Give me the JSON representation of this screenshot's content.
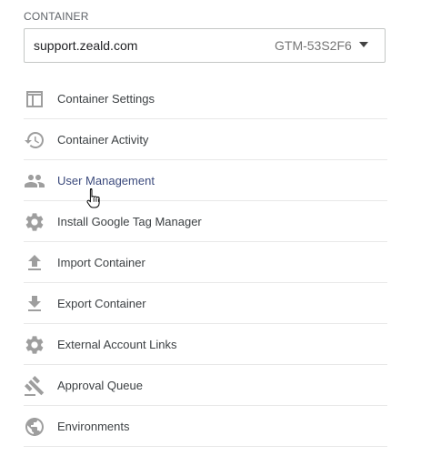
{
  "container": {
    "section_label": "CONTAINER",
    "selected_domain": "support.zeald.com",
    "selected_id": "GTM-53S2F6"
  },
  "menu": {
    "items": [
      {
        "label": "Container Settings",
        "icon": "container-settings-icon"
      },
      {
        "label": "Container Activity",
        "icon": "history-icon"
      },
      {
        "label": "User Management",
        "icon": "people-icon"
      },
      {
        "label": "Install Google Tag Manager",
        "icon": "gear-icon"
      },
      {
        "label": "Import Container",
        "icon": "upload-icon"
      },
      {
        "label": "Export Container",
        "icon": "download-icon"
      },
      {
        "label": "External Account Links",
        "icon": "gear-icon"
      },
      {
        "label": "Approval Queue",
        "icon": "gavel-icon"
      },
      {
        "label": "Environments",
        "icon": "globe-icon"
      }
    ],
    "hovered_item": "User Management"
  },
  "colors": {
    "icon_grey": "#9e9e9e",
    "label_text": "#3c4043",
    "hover_text": "#3c4b7d",
    "divider": "#e8e8e8"
  }
}
